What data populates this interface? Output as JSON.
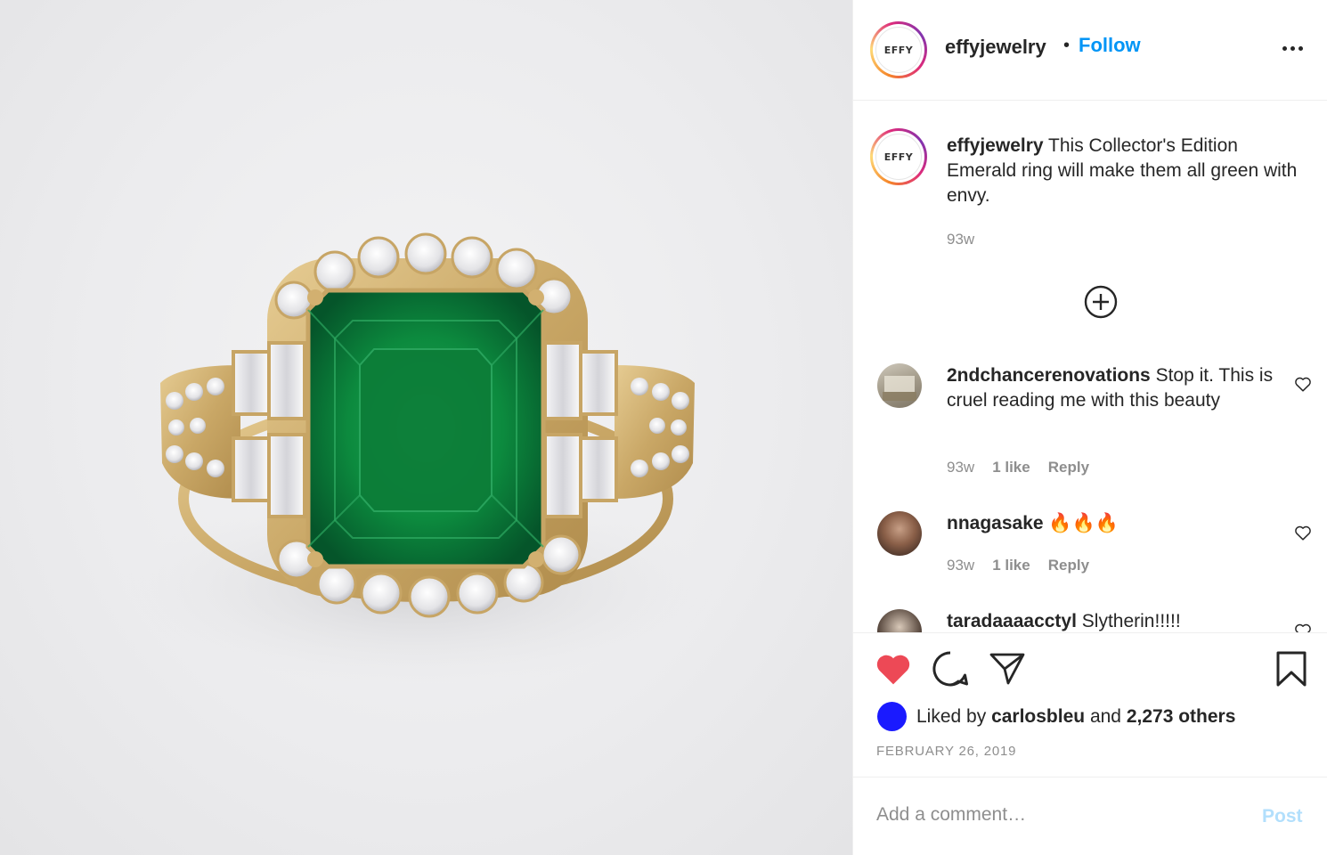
{
  "post": {
    "image_alt": "Emerald ring with diamond halo"
  },
  "header": {
    "username": "effyjewelry",
    "separator": "•",
    "follow_label": "Follow",
    "logo_text": "EFFY"
  },
  "caption": {
    "username": "effyjewelry",
    "text": "This Collector's Edition Emerald ring will make them all green with envy.",
    "time": "93w"
  },
  "comments": [
    {
      "username": "2ndchancerenovations",
      "text": "Stop it. This is cruel reading me with this beauty",
      "time": "93w",
      "likes": "1 like",
      "reply": "Reply"
    },
    {
      "username": "nnagasake",
      "text": "🔥🔥🔥",
      "time": "93w",
      "likes": "1 like",
      "reply": "Reply"
    },
    {
      "username": "taradaaaacctyl",
      "text": "Slytherin!!!!!"
    }
  ],
  "actions": {
    "liked_prefix": "Liked by",
    "liked_user": "carlosbleu",
    "liked_and": "and",
    "liked_others": "2,273 others",
    "date": "FEBRUARY 26, 2019"
  },
  "comment_box": {
    "placeholder": "Add a comment…",
    "post_label": "Post"
  },
  "colors": {
    "like_red": "#ed4956",
    "link_blue": "#0095f6",
    "post_disabled": "#b2dffc",
    "emerald": "#0f8a3c",
    "gold": "#d8b878"
  }
}
